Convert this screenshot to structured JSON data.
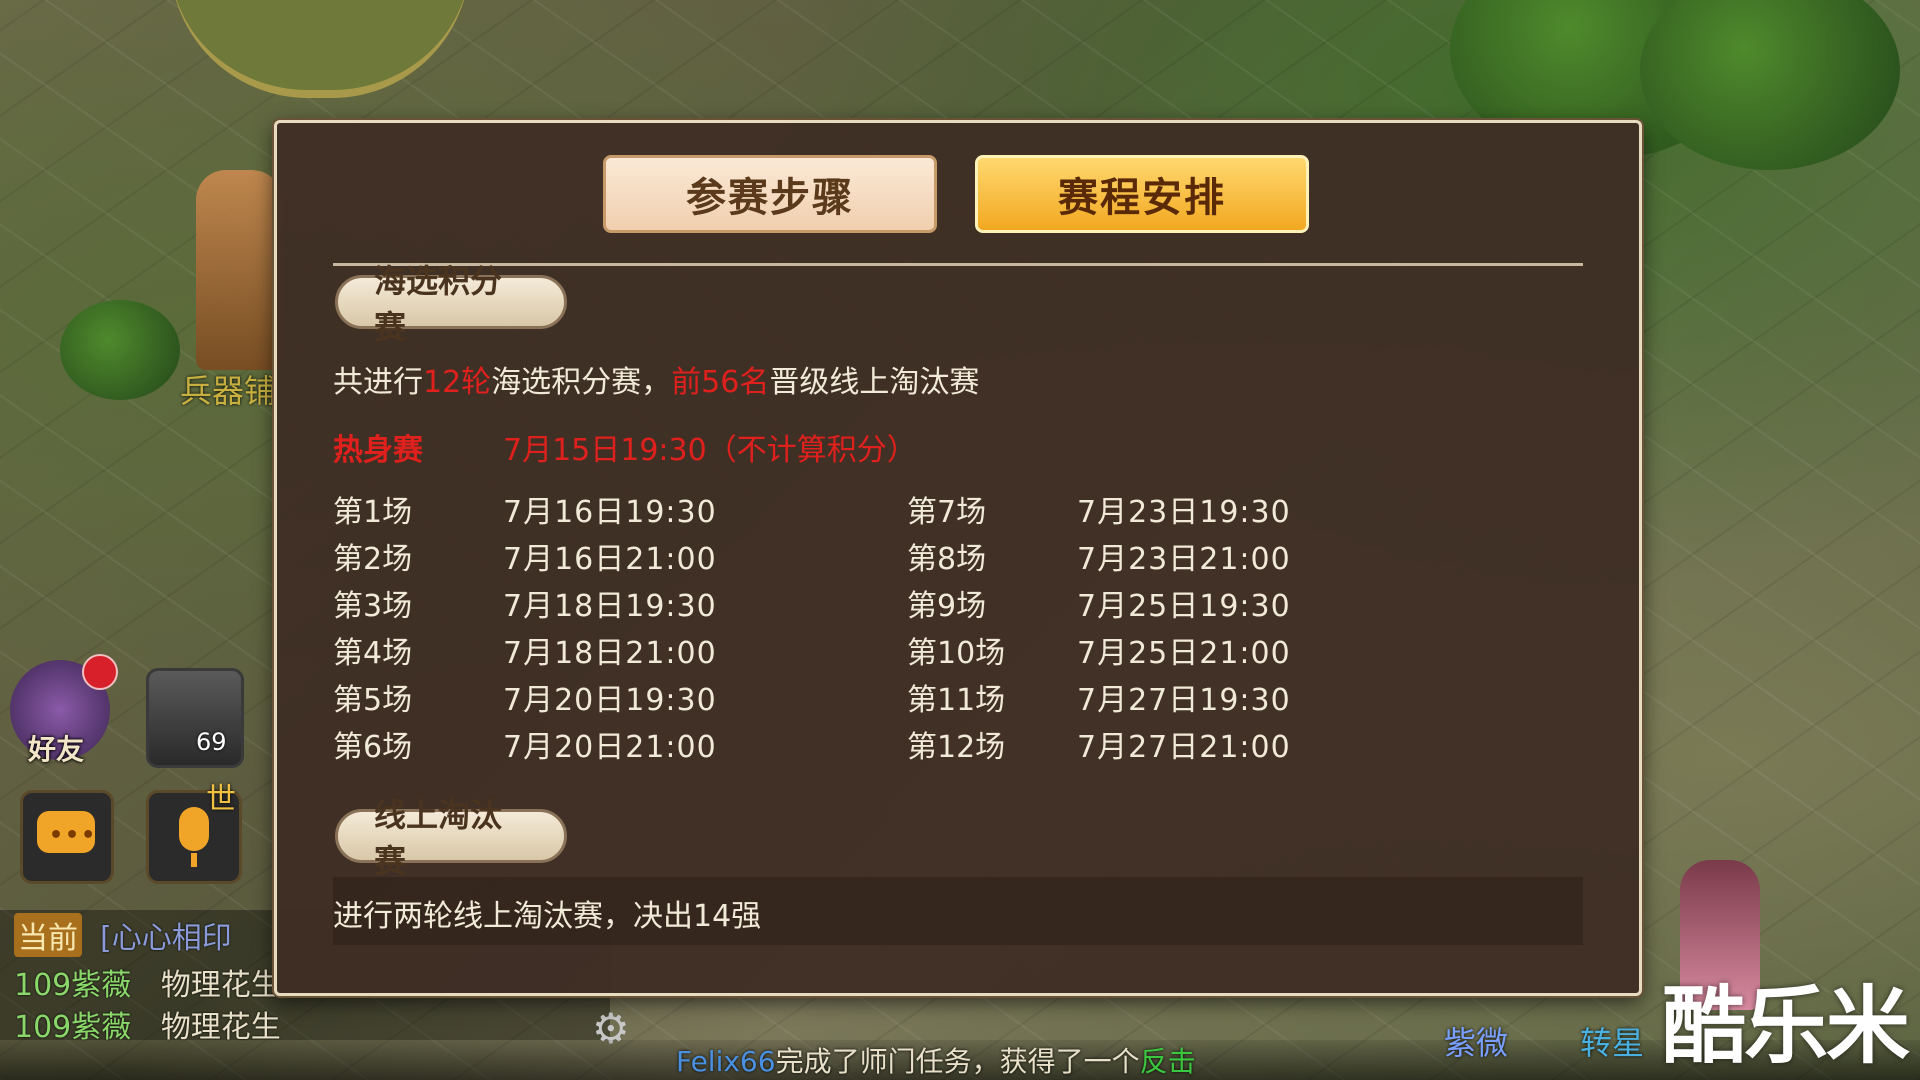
{
  "tabs": {
    "steps_label": "参赛步骤",
    "schedule_label": "赛程安排"
  },
  "qualifier": {
    "tag": "海选积分赛",
    "summary_prefix": "共进行",
    "rounds": "12轮",
    "summary_mid": "海选积分赛，",
    "top": "前56名",
    "summary_suffix": "晋级线上淘汰赛",
    "warmup_label": "热身赛",
    "warmup_time": "7月15日19:30（不计算积分）",
    "matches_left": [
      {
        "label": "第1场",
        "time": "7月16日19:30"
      },
      {
        "label": "第2场",
        "time": "7月16日21:00"
      },
      {
        "label": "第3场",
        "time": "7月18日19:30"
      },
      {
        "label": "第4场",
        "time": "7月18日21:00"
      },
      {
        "label": "第5场",
        "time": "7月20日19:30"
      },
      {
        "label": "第6场",
        "time": "7月20日21:00"
      }
    ],
    "matches_right": [
      {
        "label": "第7场",
        "time": "7月23日19:30"
      },
      {
        "label": "第8场",
        "time": "7月23日21:00"
      },
      {
        "label": "第9场",
        "time": "7月25日19:30"
      },
      {
        "label": "第10场",
        "time": "7月25日21:00"
      },
      {
        "label": "第11场",
        "time": "7月27日19:30"
      },
      {
        "label": "第12场",
        "time": "7月27日21:00"
      }
    ]
  },
  "knockout": {
    "tag": "线上淘汰赛",
    "summary": "进行两轮线上淘汰赛，决出14强"
  },
  "hud": {
    "friend_label": "好友",
    "pet_level": "69",
    "shi_label": "世",
    "npc_label": "兵器铺",
    "chat_current": "当前",
    "chat_line1": "[心心相印",
    "chat_line2_name": "109紫薇",
    "chat_line2_text": "物理花生",
    "chat_line3_name": "109紫薇",
    "chat_line3_text": "物理花生",
    "system_player": "Felix66",
    "system_mid": "完成了师门任务，获得了一个",
    "system_item": "反击",
    "right_text1": "紫微",
    "right_text2": "转星",
    "watermark": "酷乐米"
  },
  "colors": {
    "highlight_red": "#e0201c",
    "tab_active": "#f2a820",
    "panel_bg": "#3e2e24"
  }
}
